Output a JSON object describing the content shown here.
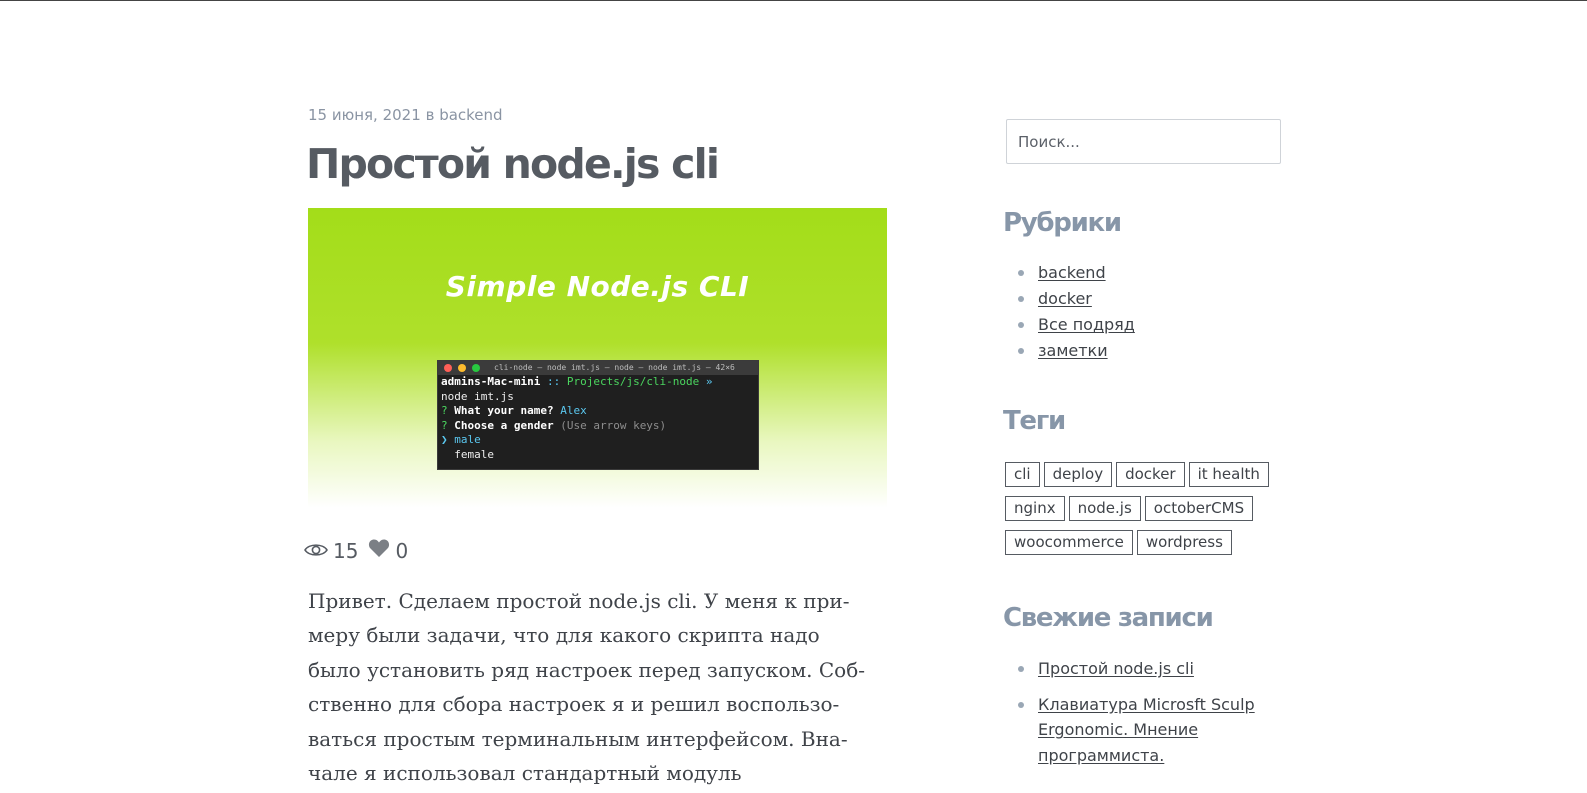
{
  "post": {
    "date": "15 июня, 2021",
    "in_word": "в",
    "category": "backend",
    "title": "Простой node.js cli",
    "hero": {
      "title": "Simple Node.js CLI",
      "terminal": {
        "window_title": "cli-node — node imt.js — node — node imt.js — 42×6",
        "prompt_host": "admins-Mac-mini",
        "prompt_sep": "::",
        "prompt_path": "Projects/js/cli-node",
        "prompt_arrow": "»",
        "command": "node imt.js",
        "q1_mark": "?",
        "q1_text": "What your name?",
        "q1_answer": "Alex",
        "q2_mark": "?",
        "q2_text": "Choose a gender",
        "q2_hint": "(Use arrow keys)",
        "option_pointer": "❯",
        "option_selected": "male",
        "option_other": "female"
      }
    },
    "views": "15",
    "likes": "0",
    "body_lines": [
      "Привет. Сделаем простой node.js cli. У меня к при-",
      "меру были задачи, что для какого скрипта надо",
      "было установить ряд настроек перед запуском. Соб-",
      "ственно для сбора настроек я и решил воспользо-",
      "ваться простым терминальным интерфейсом. Вна-",
      "чале я использовал стандартный модуль"
    ]
  },
  "sidebar": {
    "search_placeholder": "Поиск...",
    "rubrics_title": "Рубрики",
    "rubrics": [
      "backend",
      "docker",
      "Все подряд",
      "заметки"
    ],
    "tags_title": "Теги",
    "tag_rows": [
      [
        "cli",
        "deploy",
        "docker",
        "it health"
      ],
      [
        "nginx",
        "node.js",
        "octoberCMS"
      ],
      [
        "woocommerce",
        "wordpress"
      ]
    ],
    "recent_title": "Свежие записи",
    "recent": [
      "Простой node.js cli",
      "Клавиатура Microsft Sculp Ergonomic. Мнение программиста."
    ]
  },
  "colors": {
    "hero_green": "#a3dd19",
    "widget_title": "#8796a8",
    "text": "#3f4349",
    "meta": "#8a94a3"
  }
}
